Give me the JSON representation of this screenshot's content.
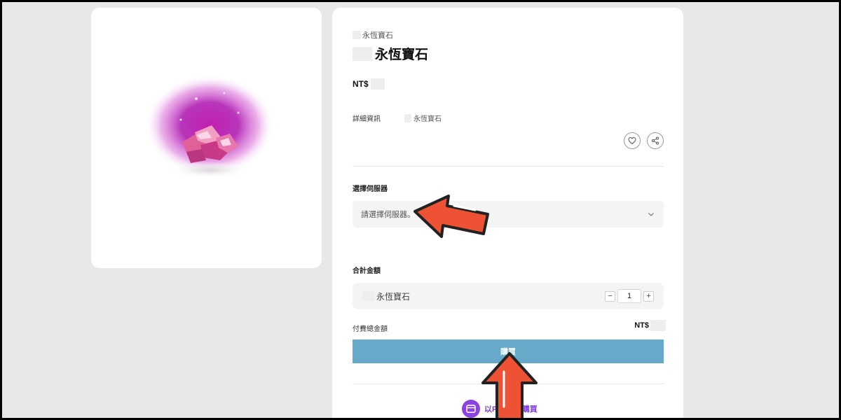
{
  "product": {
    "breadcrumb": "永恆寶石",
    "title": "永恆寶石",
    "price_prefix": "NT$"
  },
  "details": {
    "label": "詳細資訊",
    "value": "永恆寶石"
  },
  "actions": {
    "favorite_icon": "heart-icon",
    "share_icon": "share-icon"
  },
  "server": {
    "section_label": "選擇伺服器",
    "placeholder": "請選擇伺服器。"
  },
  "summary": {
    "section_label": "合計金額",
    "item_name": "永恆寶石",
    "quantity": "1",
    "minus": "−",
    "plus": "+",
    "total_label": "付費總金額",
    "total_prefix": "NT$"
  },
  "buy": {
    "label": "購買",
    "app_label": "以P E APP購買",
    "button_color": "#66a9c8",
    "app_color": "#7d3cd8"
  },
  "annotations": {
    "arrow_color": "#ee5234"
  }
}
